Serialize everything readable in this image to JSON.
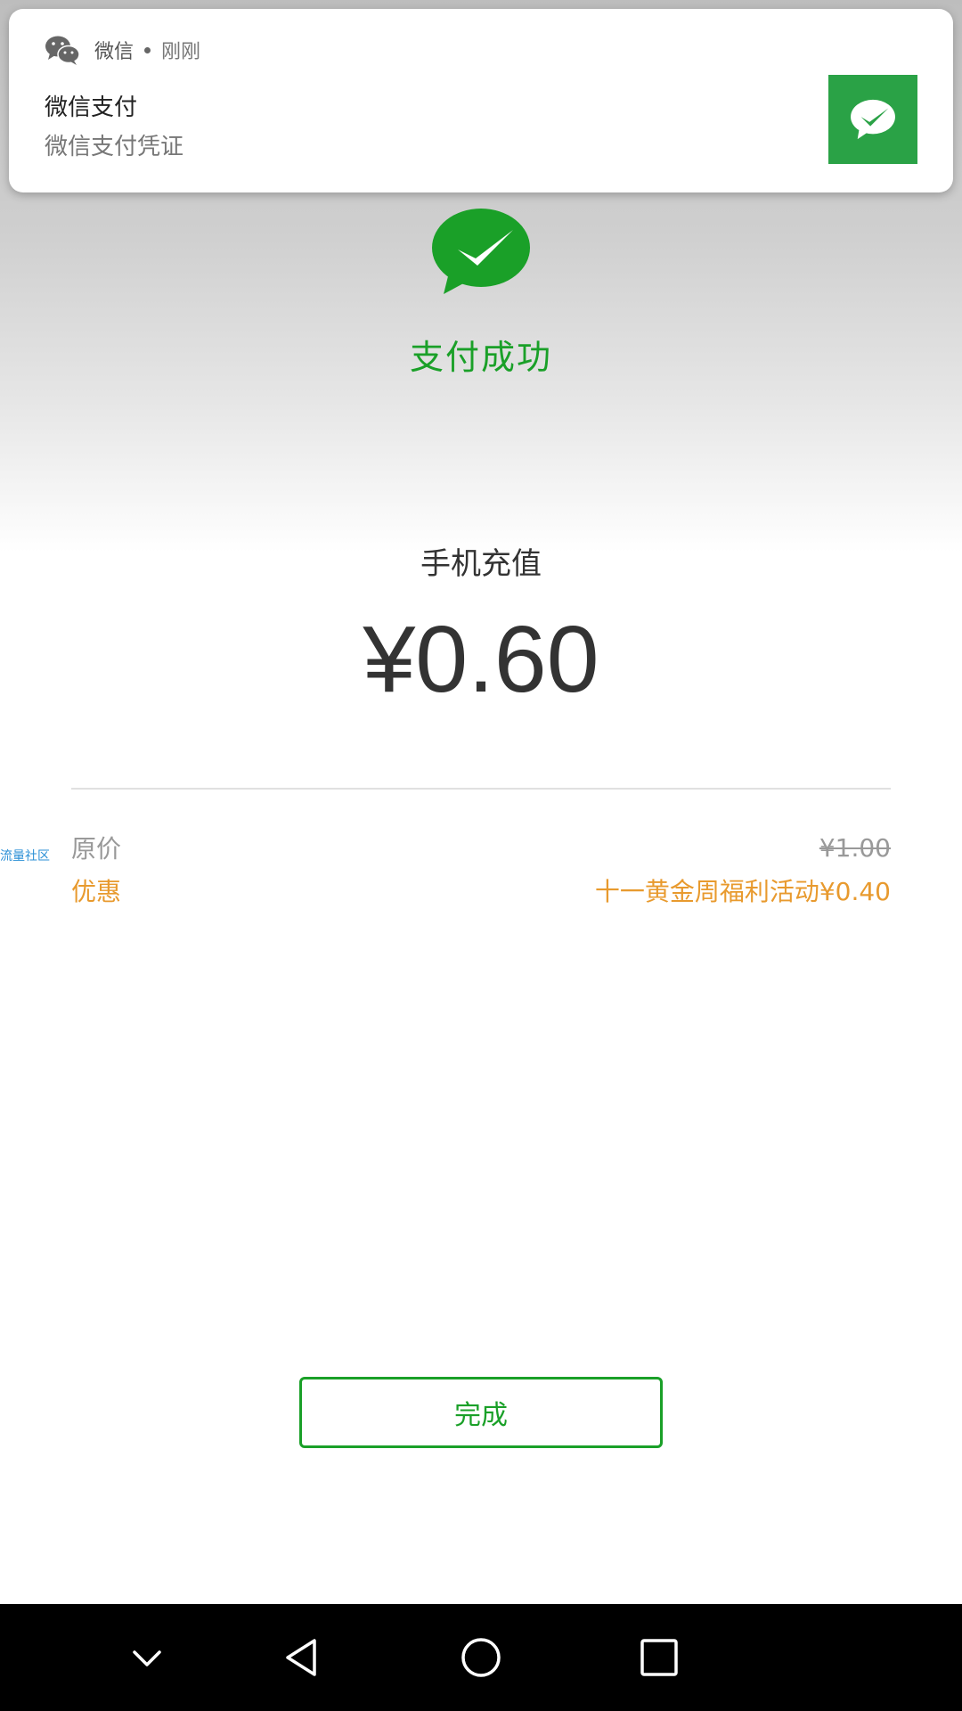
{
  "notification": {
    "app_name": "微信",
    "time": "刚刚",
    "title": "微信支付",
    "text": "微信支付凭证"
  },
  "status": {
    "title": "支付成功"
  },
  "payment": {
    "merchant": "手机充值",
    "amount": "¥0.60"
  },
  "details": {
    "original_label": "原价",
    "original_value": "¥1.00",
    "discount_label": "优惠",
    "discount_value": "十一黄金周福利活动¥0.40"
  },
  "watermark": "流量社区",
  "actions": {
    "done_label": "完成"
  },
  "colors": {
    "wechat_green": "#1aa028",
    "discount_orange": "#e89a2e"
  },
  "navbar": {
    "icons": [
      "chevron-down-icon",
      "back-icon",
      "home-icon",
      "recents-icon"
    ]
  }
}
